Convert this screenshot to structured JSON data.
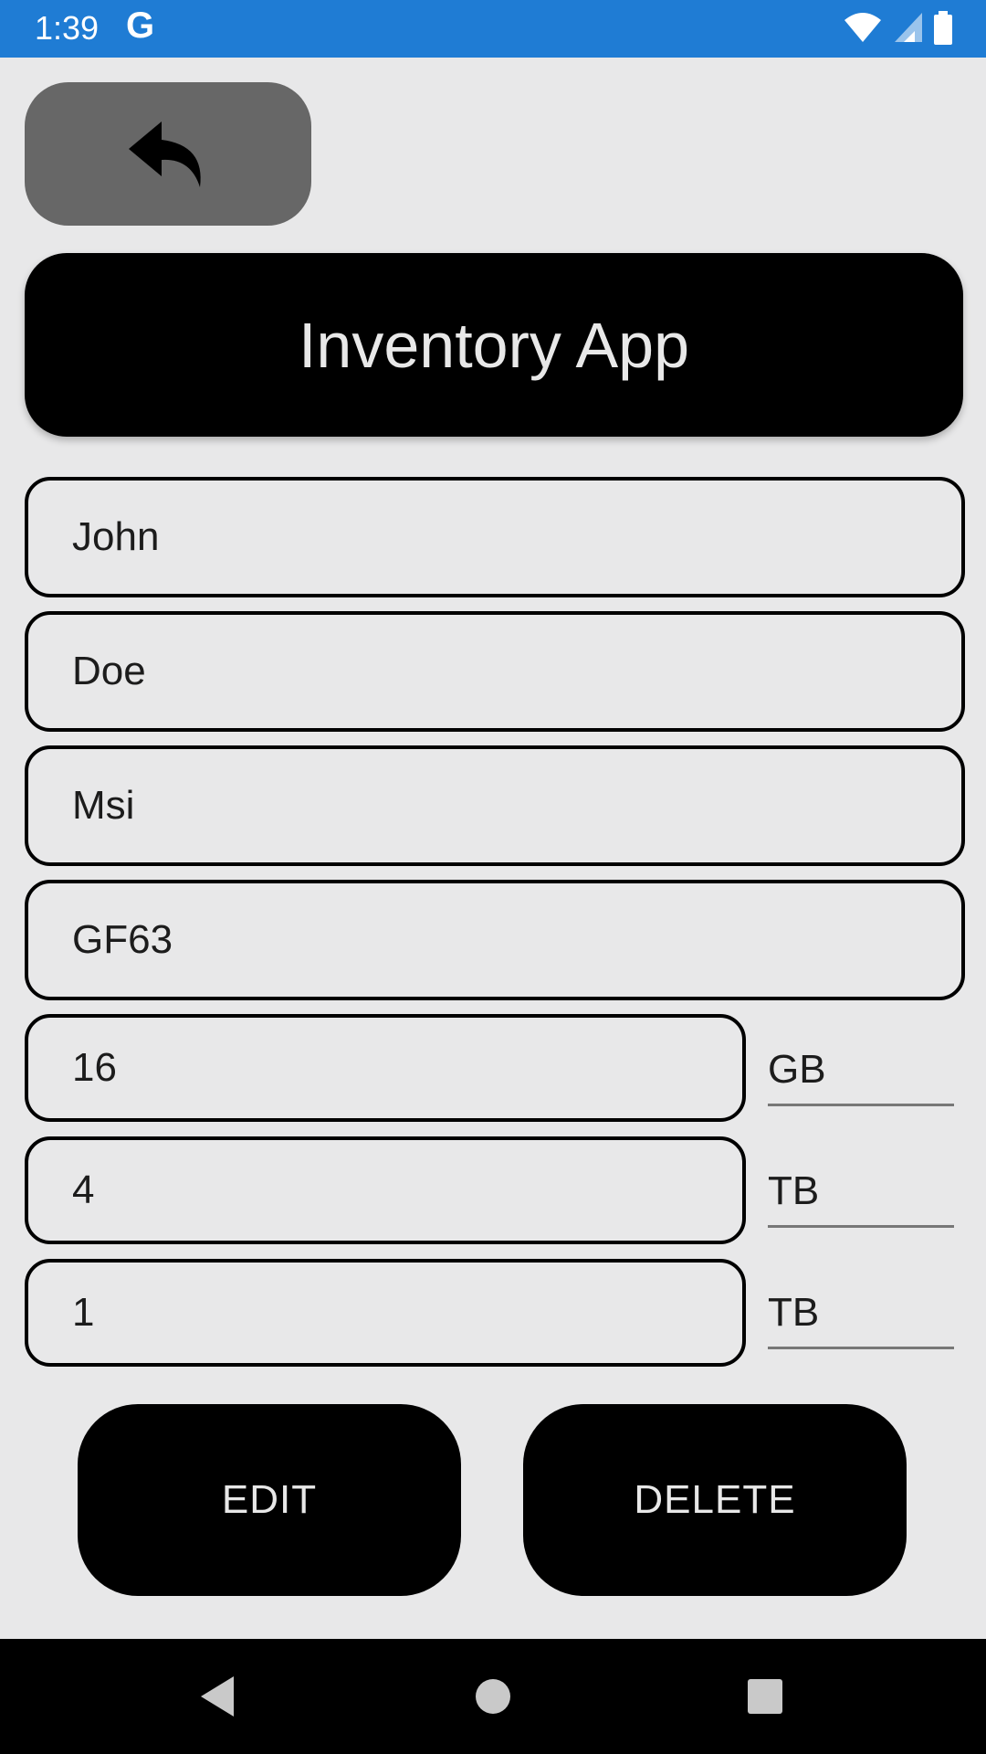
{
  "status_bar": {
    "time": "1:39",
    "g_label": "G",
    "icons": [
      "wifi-icon",
      "cell-signal-icon",
      "battery-icon"
    ],
    "color": "#1f7cd4"
  },
  "back_button": {
    "icon": "back-arrow-icon"
  },
  "header": {
    "title": "Inventory App"
  },
  "fields": {
    "first_name": "John",
    "last_name": "Doe",
    "brand": "Msi",
    "model": "GF63",
    "ram": "16",
    "ram_unit": "GB",
    "storage1": "4",
    "storage1_unit": "TB",
    "storage2": "1",
    "storage2_unit": "TB"
  },
  "actions": {
    "edit_label": "EDIT",
    "delete_label": "DELETE"
  },
  "nav_bar": {
    "icons": [
      "back-triangle-icon",
      "home-circle-icon",
      "recents-square-icon"
    ]
  },
  "colors": {
    "background": "#e8e8e9",
    "accent": "#000000",
    "back_button": "#676767"
  }
}
